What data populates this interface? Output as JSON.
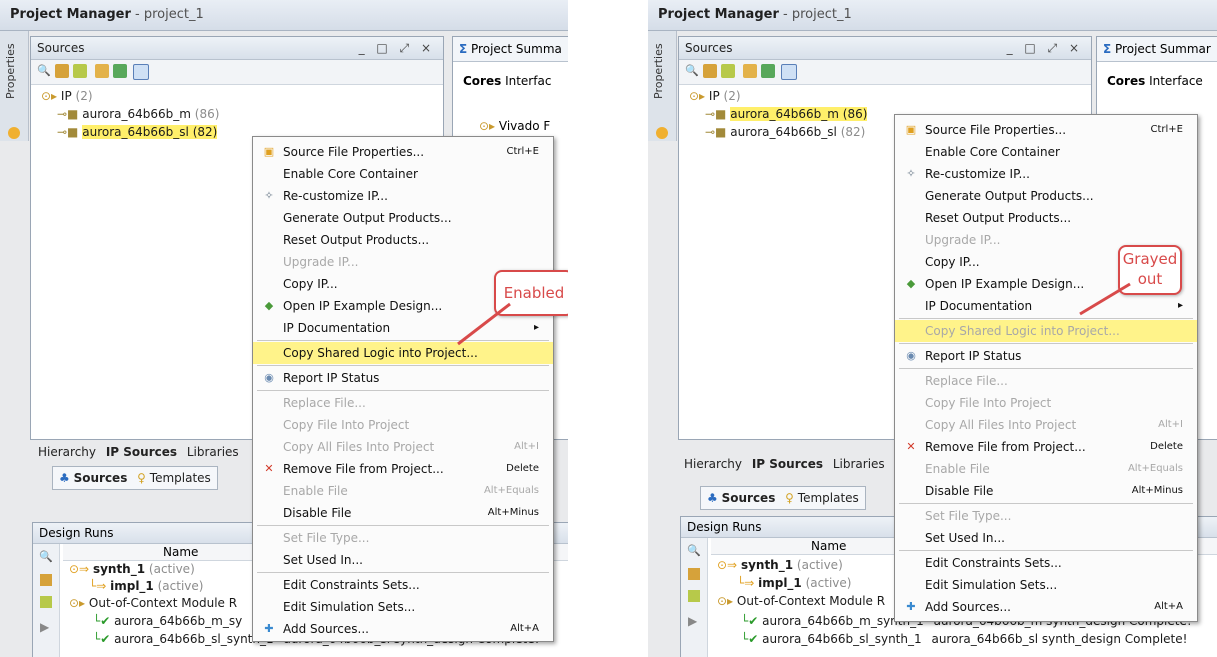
{
  "left": {
    "title": "Project Manager",
    "title_sep": " - ",
    "project": "project_1",
    "properties_tab": "Properties",
    "sources_title": "Sources",
    "window_controls": "_ □ ⤢ ×",
    "right_tab": "Project Summa",
    "right_subtabs": [
      "Cores",
      "Interfac"
    ],
    "right_tree_item": "Vivado F",
    "tree": {
      "ip_label": "IP",
      "ip_count": "(2)",
      "item1_name": "aurora_64b66b_m",
      "item1_count": "(86)",
      "item2_name": "aurora_64b66b_sl",
      "item2_count": "(82)"
    },
    "hier_tabs": [
      "Hierarchy",
      "IP Sources",
      "Libraries"
    ],
    "sub_tabs": [
      "Sources",
      "Templates"
    ],
    "design_runs": {
      "title": "Design Runs",
      "col_name": "Name",
      "rows": [
        {
          "name": "synth_1",
          "status": "(active)"
        },
        {
          "name": "impl_1",
          "status": "(active)"
        },
        {
          "name": "Out-of-Context Module R"
        },
        {
          "name": "aurora_64b66b_m_sy"
        },
        {
          "name": "aurora_64b66b_sl_synth_1",
          "extra": "aurora_64b66b_sl  synth_design Complete!"
        }
      ]
    },
    "menu": [
      {
        "label": "Source File Properties...",
        "shortcut": "Ctrl+E",
        "icon": "properties-icon"
      },
      {
        "label": "Enable Core Container"
      },
      {
        "label": "Re-customize IP...",
        "icon": "customize-icon"
      },
      {
        "label": "Generate Output Products..."
      },
      {
        "label": "Reset Output Products..."
      },
      {
        "label": "Upgrade IP...",
        "disabled": true
      },
      {
        "label": "Copy IP..."
      },
      {
        "label": "Open IP Example Design...",
        "icon": "example-icon"
      },
      {
        "label": "IP Documentation",
        "submenu": "▸"
      },
      {
        "label": "Copy Shared Logic into Project...",
        "highlight": true
      },
      {
        "label": "Report IP Status",
        "icon": "report-icon"
      },
      {
        "label": "Replace File...",
        "disabled": true
      },
      {
        "label": "Copy File Into Project",
        "disabled": true
      },
      {
        "label": "Copy All Files Into Project",
        "shortcut": "Alt+I",
        "disabled": true
      },
      {
        "label": "Remove File from Project...",
        "shortcut": "Delete",
        "icon": "remove-icon"
      },
      {
        "label": "Enable File",
        "shortcut": "Alt+Equals",
        "disabled": true
      },
      {
        "label": "Disable File",
        "shortcut": "Alt+Minus"
      },
      {
        "label": "Set File Type...",
        "disabled": true
      },
      {
        "label": "Set Used In..."
      },
      {
        "label": "Edit Constraints Sets..."
      },
      {
        "label": "Edit Simulation Sets..."
      },
      {
        "label": "Add Sources...",
        "shortcut": "Alt+A",
        "icon": "add-icon"
      }
    ],
    "callout": "Enabled"
  },
  "right": {
    "title": "Project Manager",
    "title_sep": " - ",
    "project": "project_1",
    "properties_tab": "Properties",
    "sources_title": "Sources",
    "window_controls": "_ □ ⤢ ×",
    "right_tab": "Project Summar",
    "right_subtabs": [
      "Cores",
      "Interface"
    ],
    "tree": {
      "ip_label": "IP",
      "ip_count": "(2)",
      "item1_name": "aurora_64b66b_m",
      "item1_count": "(86)",
      "item2_name": "aurora_64b66b_sl",
      "item2_count": "(82)"
    },
    "hier_tabs": [
      "Hierarchy",
      "IP Sources",
      "Libraries"
    ],
    "sub_tabs": [
      "Sources",
      "Templates"
    ],
    "design_runs": {
      "title": "Design Runs",
      "col_name": "Name",
      "rows": [
        {
          "name": "synth_1",
          "status": "(active)"
        },
        {
          "name": "impl_1",
          "status": "(active)"
        },
        {
          "name": "Out-of-Context Module R"
        },
        {
          "name": "aurora_64b66b_m_synth_1",
          "extra": "aurora_64b66b_m  synth_design Complete!"
        },
        {
          "name": "aurora_64b66b_sl_synth_1",
          "extra": "aurora_64b66b_sl  synth_design Complete!"
        }
      ]
    },
    "menu": [
      {
        "label": "Source File Properties...",
        "shortcut": "Ctrl+E",
        "icon": "properties-icon"
      },
      {
        "label": "Enable Core Container"
      },
      {
        "label": "Re-customize IP...",
        "icon": "customize-icon"
      },
      {
        "label": "Generate Output Products..."
      },
      {
        "label": "Reset Output Products..."
      },
      {
        "label": "Upgrade IP...",
        "disabled": true
      },
      {
        "label": "Copy IP..."
      },
      {
        "label": "Open IP Example Design...",
        "icon": "example-icon"
      },
      {
        "label": "IP Documentation",
        "submenu": "▸"
      },
      {
        "label": "Copy Shared Logic into Project...",
        "disabled": true,
        "highlight": true
      },
      {
        "label": "Report IP Status",
        "icon": "report-icon"
      },
      {
        "label": "Replace File...",
        "disabled": true
      },
      {
        "label": "Copy File Into Project",
        "disabled": true
      },
      {
        "label": "Copy All Files Into Project",
        "shortcut": "Alt+I",
        "disabled": true
      },
      {
        "label": "Remove File from Project...",
        "shortcut": "Delete",
        "icon": "remove-icon"
      },
      {
        "label": "Enable File",
        "shortcut": "Alt+Equals",
        "disabled": true
      },
      {
        "label": "Disable File",
        "shortcut": "Alt+Minus"
      },
      {
        "label": "Set File Type...",
        "disabled": true
      },
      {
        "label": "Set Used In..."
      },
      {
        "label": "Edit Constraints Sets..."
      },
      {
        "label": "Edit Simulation Sets..."
      },
      {
        "label": "Add Sources...",
        "shortcut": "Alt+A",
        "icon": "add-icon"
      }
    ],
    "callout": "Grayed out"
  },
  "colors": {
    "highlight": "#ffef6a",
    "callout_red": "#d84a4a",
    "disabled_text": "#a8a8a8"
  }
}
